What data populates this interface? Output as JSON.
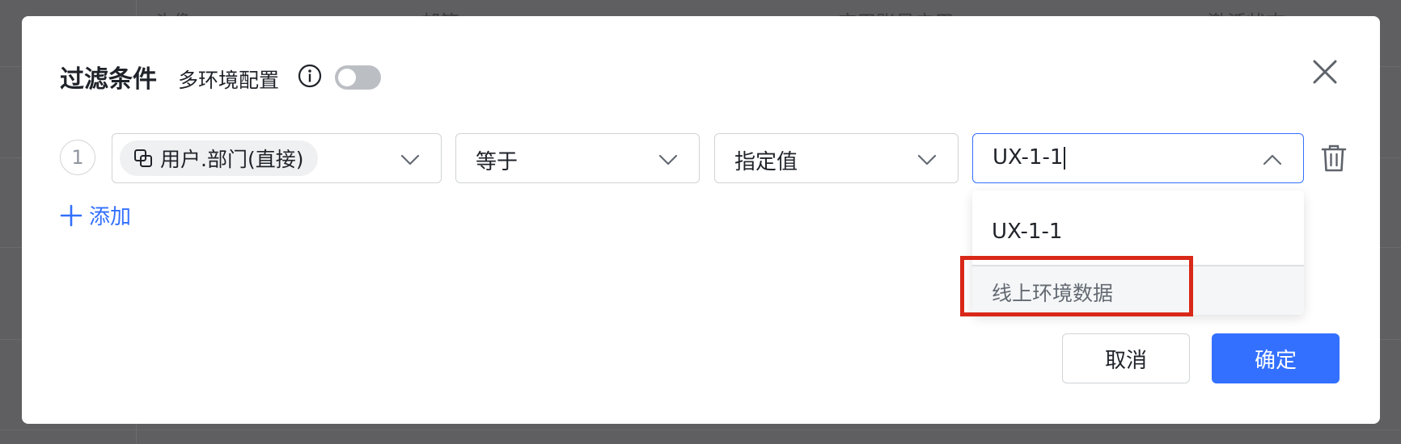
{
  "background": {
    "headers": [
      "头像",
      "邮箱",
      "应用账号启用",
      "激活状态"
    ]
  },
  "modal": {
    "title": "过滤条件",
    "multi_env_label": "多环境配置",
    "multi_env_enabled": false,
    "close_icon": "close-icon"
  },
  "condition": {
    "index": "1",
    "field": "用户.部门(直接)",
    "operator": "等于",
    "value_mode": "指定值",
    "value_input": "UX-1-1"
  },
  "dropdown": {
    "options": [
      "UX-1-1"
    ],
    "group_label": "线上环境数据"
  },
  "actions": {
    "add_label": "添加",
    "cancel_label": "取消",
    "confirm_label": "确定"
  },
  "colors": {
    "primary": "#3370ff",
    "highlight": "#d82818"
  }
}
